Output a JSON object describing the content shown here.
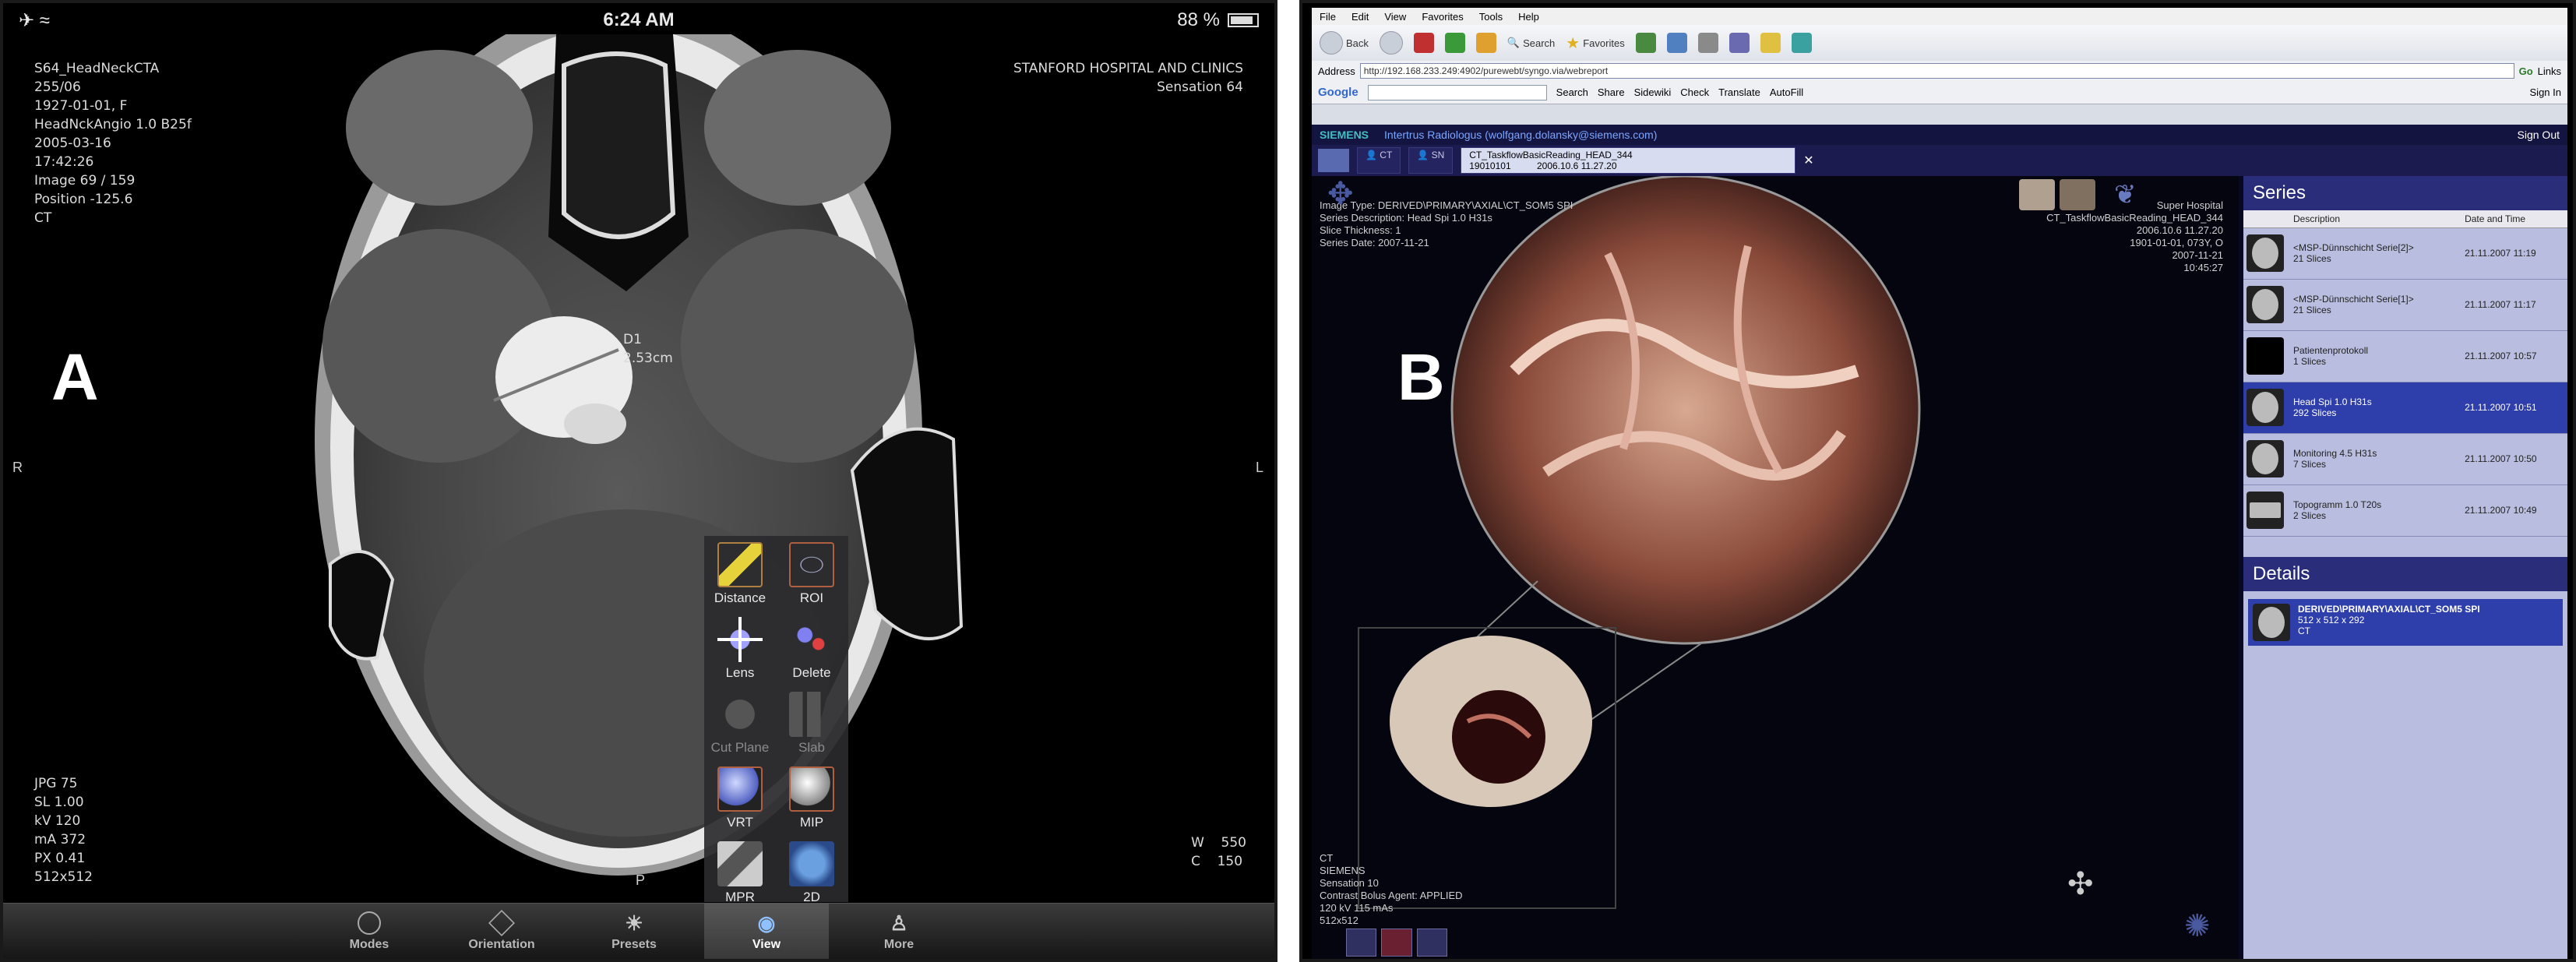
{
  "panel_a": {
    "letter": "A",
    "status": {
      "time": "6:24 AM",
      "battery": "88 %"
    },
    "overlay_top_left": [
      "S64_HeadNeckCTA",
      "255/06",
      "1927-01-01, F",
      "HeadNckAngio  1.0  B25f",
      "2005-03-16",
      "17:42:26",
      "Image 69 / 159",
      "Position -125.6",
      "CT"
    ],
    "overlay_top_right": [
      "STANFORD HOSPITAL AND CLINICS",
      "Sensation 64"
    ],
    "overlay_bottom_left": [
      "JPG 75",
      "SL 1.00",
      "kV 120",
      "mA 372",
      "PX 0.41",
      "512x512"
    ],
    "overlay_bottom_right": [
      "W",
      "550",
      "C",
      "150"
    ],
    "orientation": {
      "left": "R",
      "right": "L",
      "bottom": "P"
    },
    "measurement": {
      "label": "D1",
      "value": "2.53cm"
    },
    "tools": [
      {
        "label": "Distance",
        "icon": "ruler-icon"
      },
      {
        "label": "ROI",
        "icon": "roi-ellipse-icon"
      },
      {
        "label": "Lens",
        "icon": "lens-crosshair-icon"
      },
      {
        "label": "Delete",
        "icon": "delete-icon"
      },
      {
        "label": "Cut Plane",
        "icon": "cut-plane-icon"
      },
      {
        "label": "Slab",
        "icon": "slab-icon"
      },
      {
        "label": "VRT",
        "icon": "vrt-sphere-icon"
      },
      {
        "label": "MIP",
        "icon": "mip-sphere-icon"
      },
      {
        "label": "MPR",
        "icon": "mpr-icon"
      },
      {
        "label": "2D",
        "icon": "2d-icon"
      }
    ],
    "tabs": [
      {
        "label": "Modes",
        "icon": "modes-icon"
      },
      {
        "label": "Orientation",
        "icon": "orientation-cube-icon"
      },
      {
        "label": "Presets",
        "icon": "presets-sun-icon"
      },
      {
        "label": "View",
        "icon": "view-eye-icon"
      },
      {
        "label": "More",
        "icon": "more-person-icon"
      }
    ],
    "active_tab": "View"
  },
  "panel_b": {
    "letter": "B",
    "menu": [
      "File",
      "Edit",
      "View",
      "Favorites",
      "Tools",
      "Help"
    ],
    "toolbar": {
      "back": "Back",
      "search": "Search",
      "favorites": "Favorites"
    },
    "address": {
      "label": "Address",
      "url": "http://192.168.233.249:4902/purewebt/syngo.via/webreport",
      "go": "Go",
      "links": "Links"
    },
    "google_bar": {
      "brand": "Google",
      "search": "Search",
      "share": "Share",
      "sidewiki": "Sidewiki",
      "check": "Check",
      "translate": "Translate",
      "autofill": "AutoFill",
      "signin": "Sign In"
    },
    "syngo_header": {
      "brand": "SIEMENS",
      "user": "Intertrus Radiologus (wolfgang.dolansky@siemens.com)",
      "signout": "Sign Out"
    },
    "patient_tabs": [
      {
        "label": "CT",
        "sub": ""
      },
      {
        "label": "SN",
        "sub": ""
      }
    ],
    "active_patient": {
      "name": "CT_TaskflowBasicReading_HEAD_344",
      "id": "19010101",
      "date": "2006.10.6 11.27.20"
    },
    "viewer_top_left": [
      "Image Type: DERIVED\\PRIMARY\\AXIAL\\CT_SOM5 SPI",
      "Series Description: Head Spi  1.0  H31s",
      "Slice Thickness: 1",
      "Series Date: 2007-11-21"
    ],
    "viewer_top_right": [
      "Super Hospital",
      "CT_TaskflowBasicReading_HEAD_344",
      "2006.10.6 11.27.20",
      "1901-01-01, 073Y, O",
      "2007-11-21",
      "10:45:27"
    ],
    "viewer_bottom_left": [
      "CT",
      "SIEMENS",
      "Sensation 10",
      "Contrast Bolus Agent: APPLIED",
      "120 kV  115 mAs",
      "512x512"
    ],
    "series_panel": {
      "title": "Series",
      "columns": [
        "Description",
        "Date and Time"
      ],
      "rows": [
        {
          "desc": "<MSP-Dünnschicht Serie[2]>",
          "count": "21 Slices",
          "date": "21.11.2007 11:19",
          "selected": false
        },
        {
          "desc": "<MSP-Dünnschicht Serie[1]>",
          "count": "21 Slices",
          "date": "21.11.2007 11:17",
          "selected": false
        },
        {
          "desc": "Patientenprotokoll",
          "count": "1 Slices",
          "date": "21.11.2007 10:57",
          "selected": false
        },
        {
          "desc": "Head Spi  1.0  H31s",
          "count": "292 Slices",
          "date": "21.11.2007 10:51",
          "selected": true
        },
        {
          "desc": "Monitoring  4.5  H31s",
          "count": "7 Slices",
          "date": "21.11.2007 10:50",
          "selected": false
        },
        {
          "desc": "Topogramm  1.0  T20s",
          "count": "2 Slices",
          "date": "21.11.2007 10:49",
          "selected": false
        }
      ]
    },
    "details_panel": {
      "title": "Details",
      "type": "DERIVED\\PRIMARY\\AXIAL\\CT_SOM5 SPI",
      "dims": "512 x 512 x 292",
      "modality": "CT"
    }
  }
}
